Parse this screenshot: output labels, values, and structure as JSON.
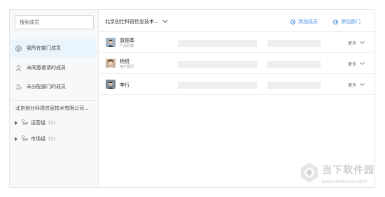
{
  "search": {
    "placeholder": "搜索成员"
  },
  "sidebar": {
    "items": [
      {
        "label": "我所在部门成员",
        "icon": "user-circle-icon",
        "active": true
      },
      {
        "label": "未同意邀请的成员",
        "icon": "user-icon",
        "active": false
      },
      {
        "label": "未分配部门的成员",
        "icon": "user-plus-icon",
        "active": false
      }
    ],
    "org_name": "北京创仕科锐信息技术有限公司...",
    "groups": [
      {
        "name": "运营组",
        "count": "(1)"
      },
      {
        "name": "市场组",
        "count": "(1)"
      }
    ]
  },
  "header": {
    "department": "北京创仕科锐信息技术...",
    "add_member": "添加成员",
    "add_department": "添加部门"
  },
  "members": [
    {
      "name": "曾德季",
      "title": "产品经理",
      "more": "更多"
    },
    {
      "name": "杨悦",
      "title": "用户顾问",
      "more": "更多"
    },
    {
      "name": "李行",
      "title": "",
      "more": "更多"
    }
  ],
  "watermark": {
    "brand": "当下软件园",
    "url": "www.downxia.com"
  },
  "colors": {
    "accent": "#4a90e2",
    "active_bg": "#eaf4fd",
    "placeholder_bar": "#eeeeee"
  }
}
